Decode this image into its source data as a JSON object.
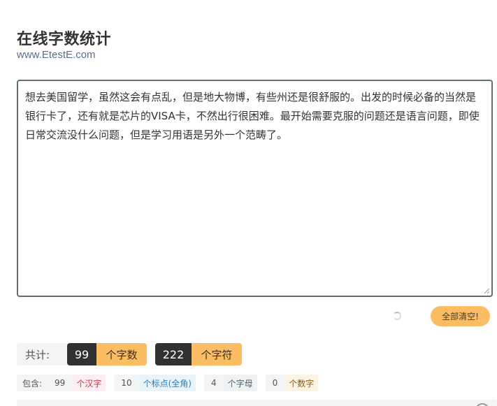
{
  "header": {
    "title": "在线字数统计",
    "subtitle": "www.EtestE.com"
  },
  "editor": {
    "text": "想去美国留学，虽然这会有点乱，但是地大物博，有些州还是很舒服的。出发的时候必备的当然是银行卡了，还有就是芯片的VISA卡，不然出行很困难。最开始需要克服的问题还是语言问题，即使日常交流没什么问题，但是学习用语是另外一个范畴了。"
  },
  "actions": {
    "clear_label": "全部清空!"
  },
  "totals": {
    "label": "共计:",
    "chars_count": "99",
    "chars_label": "个字数",
    "symbols_count": "222",
    "symbols_label": "个字符"
  },
  "details": {
    "label": "包含:",
    "han_count": "99",
    "han_label": "个汉字",
    "punct_count": "10",
    "punct_label": "个标点(全角)",
    "letter_count": "4",
    "letter_label": "个字母",
    "digit_count": "0",
    "digit_label": "个数字"
  },
  "colors": {
    "accent": "#fbbd63",
    "dark": "#2f3133",
    "border": "#5f6f72"
  }
}
